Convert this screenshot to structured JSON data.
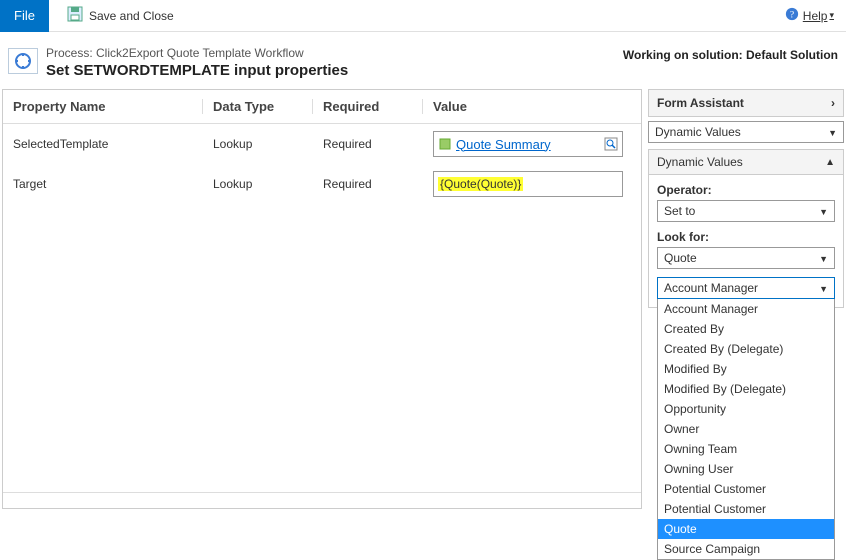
{
  "toolbar": {
    "file_label": "File",
    "save_close_label": "Save and Close",
    "help_label": "Help"
  },
  "header": {
    "process_prefix": "Process: ",
    "process_name": "Click2Export Quote Template Workflow",
    "title": "Set SETWORDTEMPLATE input properties",
    "solution_prefix": "Working on solution: ",
    "solution_name": "Default Solution"
  },
  "grid": {
    "columns": {
      "property_name": "Property Name",
      "data_type": "Data Type",
      "required": "Required",
      "value": "Value"
    },
    "rows": [
      {
        "property": "SelectedTemplate",
        "datatype": "Lookup",
        "required": "Required",
        "value_type": "lookup",
        "value_text": "Quote Summary"
      },
      {
        "property": "Target",
        "datatype": "Lookup",
        "required": "Required",
        "value_type": "slug",
        "value_text": "{Quote(Quote)}"
      }
    ]
  },
  "assistant": {
    "title": "Form Assistant",
    "dynamic_values_label": "Dynamic Values",
    "section_label": "Dynamic Values",
    "operator_label": "Operator:",
    "operator_value": "Set to",
    "lookfor_label": "Look for:",
    "lookfor_entity": "Quote",
    "lookfor_attribute_selected": "Account Manager",
    "dropdown_items": [
      "Account Manager",
      "Created By",
      "Created By (Delegate)",
      "Modified By",
      "Modified By (Delegate)",
      "Opportunity",
      "Owner",
      "Owning Team",
      "Owning User",
      "Potential Customer",
      "Potential Customer",
      "Quote",
      "Source Campaign"
    ],
    "dropdown_selected_index": 11
  }
}
